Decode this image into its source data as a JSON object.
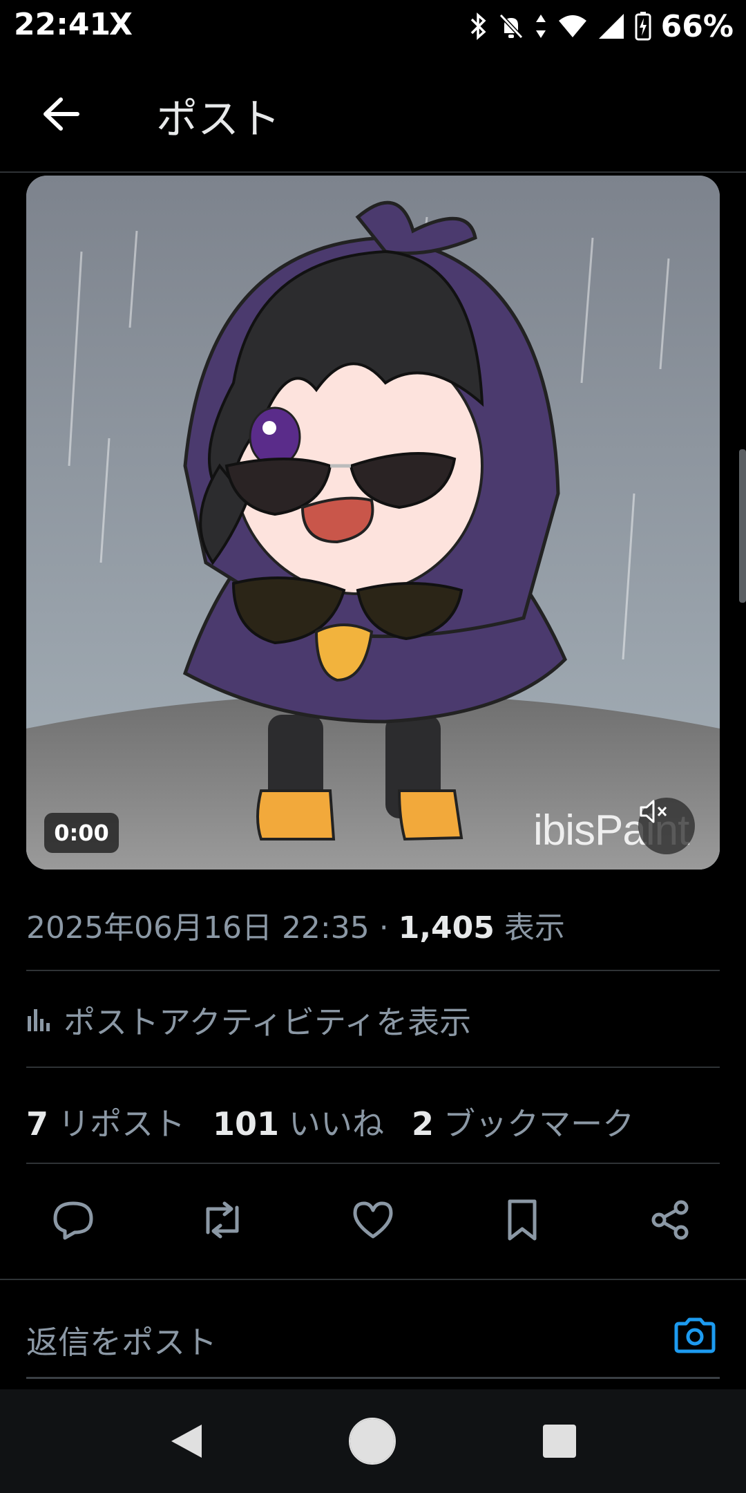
{
  "status_bar": {
    "time": "22:41",
    "app_icon": "X",
    "battery": "66%",
    "icons": [
      "bluetooth-icon",
      "bell-off-icon",
      "data-arrows-icon",
      "wifi-icon",
      "signal-icon",
      "battery-charging-icon"
    ]
  },
  "header": {
    "title": "ポスト",
    "back_icon": "arrow-left-icon"
  },
  "video": {
    "timestamp": "0:00",
    "watermark": "ibisPaint",
    "mute_icon": "volume-muted-icon"
  },
  "meta": {
    "datetime": "2025年06月16日 22:35",
    "separator": " · ",
    "views": "1,405",
    "views_label": "表示"
  },
  "activity": {
    "label": "ポストアクティビティを表示",
    "icon": "analytics-icon"
  },
  "stats": {
    "reposts": "7",
    "reposts_label": "リポスト",
    "likes": "101",
    "likes_label": "いいね",
    "bookmarks": "2",
    "bookmarks_label": "ブックマーク"
  },
  "reply": {
    "placeholder": "返信をポスト"
  },
  "colors": {
    "background": "#000000",
    "text_primary": "#e7e9ea",
    "text_secondary": "#8b98a5",
    "divider": "#2f3336",
    "accent": "#1d9bf0"
  }
}
